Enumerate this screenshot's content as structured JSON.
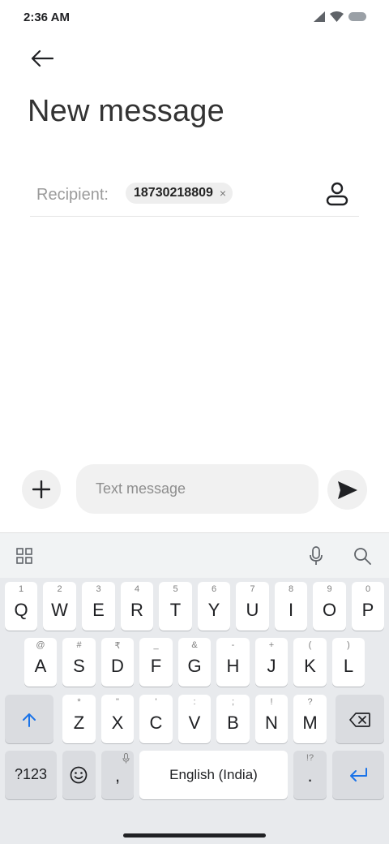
{
  "status_bar": {
    "time": "2:36 AM"
  },
  "header": {
    "title": "New message"
  },
  "recipient": {
    "label": "Recipient:",
    "chip": "18730218809",
    "chip_remove": "×"
  },
  "compose": {
    "placeholder": "Text message"
  },
  "keyboard": {
    "row1": [
      {
        "key": "Q",
        "hint": "1"
      },
      {
        "key": "W",
        "hint": "2"
      },
      {
        "key": "E",
        "hint": "3"
      },
      {
        "key": "R",
        "hint": "4"
      },
      {
        "key": "T",
        "hint": "5"
      },
      {
        "key": "Y",
        "hint": "6"
      },
      {
        "key": "U",
        "hint": "7"
      },
      {
        "key": "I",
        "hint": "8"
      },
      {
        "key": "O",
        "hint": "9"
      },
      {
        "key": "P",
        "hint": "0"
      }
    ],
    "row2": [
      {
        "key": "A",
        "hint": "@"
      },
      {
        "key": "S",
        "hint": "#"
      },
      {
        "key": "D",
        "hint": "₹"
      },
      {
        "key": "F",
        "hint": "_"
      },
      {
        "key": "G",
        "hint": "&"
      },
      {
        "key": "H",
        "hint": "-"
      },
      {
        "key": "J",
        "hint": "+"
      },
      {
        "key": "K",
        "hint": "("
      },
      {
        "key": "L",
        "hint": ")"
      }
    ],
    "row3": [
      {
        "key": "Z",
        "hint": "*"
      },
      {
        "key": "X",
        "hint": "\""
      },
      {
        "key": "C",
        "hint": "'"
      },
      {
        "key": "V",
        "hint": ":"
      },
      {
        "key": "B",
        "hint": ";"
      },
      {
        "key": "N",
        "hint": "!"
      },
      {
        "key": "M",
        "hint": "?"
      }
    ],
    "symbols_label": "?123",
    "comma": ",",
    "space_label": "English (India)",
    "period": ".",
    "period_hint": "!?"
  },
  "colors": {
    "accent": "#1a73e8",
    "keyboard_bg": "#e8eaed"
  }
}
